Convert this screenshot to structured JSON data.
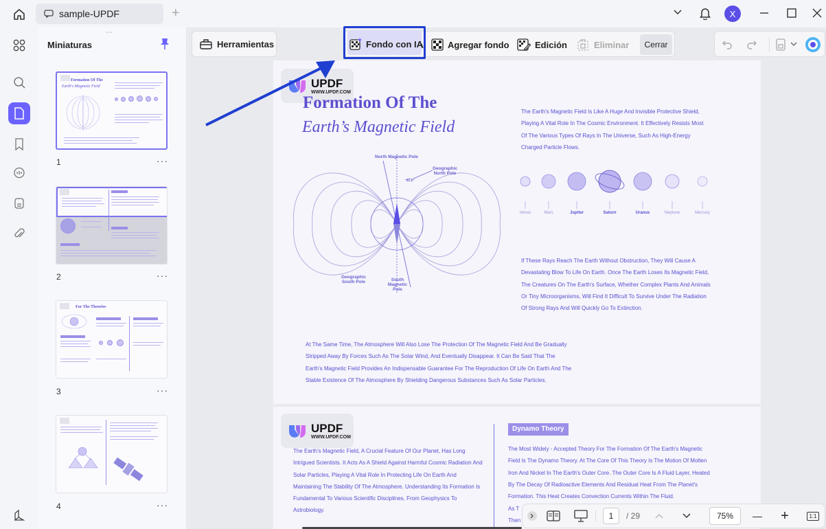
{
  "window": {
    "tab_title": "sample-UPDF",
    "new_tab": "+",
    "avatar_letter": "X",
    "accent": "#6c63ff"
  },
  "rail": {
    "items": [
      "apps-icon",
      "search-icon",
      "pages-icon",
      "bookmark-icon",
      "comment-icon",
      "stamp-icon",
      "attachment-icon",
      "layers-icon"
    ]
  },
  "thumbnails": {
    "title": "Miniaturas",
    "more": "···",
    "drag_handle": "⋯",
    "pages": [
      {
        "number": "1",
        "heading": "Formation Of The",
        "subheading": "Earth's Magnetic Field"
      },
      {
        "number": "2"
      },
      {
        "number": "3",
        "heading": "For The Theories"
      },
      {
        "number": "4"
      }
    ]
  },
  "toolbar": {
    "tools_label": "Herramientas",
    "ai_background_label": "Fondo con IA",
    "add_background_label": "Agregar fondo",
    "edit_label": "Edición",
    "delete_label": "Eliminar",
    "close_label": "Cerrar"
  },
  "page1": {
    "logo_text": "UPDF",
    "logo_url": "WWW.UPDF.COM",
    "title_line1": "Formation Of The",
    "title_line2": "Earth’s Magnetic Field",
    "intro": "The Earth's Magnetic Field Is Like A Huge And Invisible Protective Shield, Playing A Vital Role In The Cosmic Environment. It Effectively Resists Most Of The Various Types Of Rays In The Universe, Such As High-Energy Charged Particle Flows.",
    "rays": "If These Rays Reach The Earth Without Obstruction, They Will Cause A Devastating Blow To Life On Earth. Once The Earth Loses Its Magnetic Field, The Creatures On The Earth's Surface, Whether Complex Plants And Animals Or Tiny Microorganisms, Will Find It Difficult To Survive Under The Radiation Of Strong Rays And Will Quickly Go To Extinction.",
    "atmosphere": "At The Same Time, The Atmosphere Will Also Lose The Protection Of The Magnetic Field And Be Gradually Stripped Away By Forces Such As The Solar Wind, And Eventually Disappear. It Can Be Said That The Earth's Magnetic Field Provides An Indispensable Guarantee For The Reproduction Of Life On Earth And The Stable Existence Of The Atmosphere By Shielding Dangerous Substances Such As Solar Particles.",
    "diagram": {
      "north_magnetic_pole": "North Magnetic Pole",
      "geographic_north_pole": "Geographic North Pole",
      "geographic_south_pole": "Geographic South Pole",
      "south_magnetic_pole": "South Magnetic Pole",
      "angle": "11.5°"
    },
    "planets": [
      "Venus",
      "Mars",
      "Jupiter",
      "Saturn",
      "Uranus",
      "Neptune",
      "Mercury"
    ],
    "planets_bold": [
      false,
      false,
      true,
      true,
      true,
      false,
      false
    ]
  },
  "page2": {
    "logo_text": "UPDF",
    "logo_url": "WWW.UPDF.COM",
    "left_text": "The Earth's Magnetic Field, A Crucial Feature Of Our Planet, Has Long Intrigued Scientists. It Acts As A Shield Against Harmful Cosmic Radiation And Solar Particles, Playing A Vital Role In Protecting Life On Earth And Maintaining The Stability Of The Atmosphere. Understanding Its Formation Is Fundamental To Various Scientific Disciplines, From Geophysics To Astrobiology.",
    "dynamo_title": "Dynamo Theory",
    "dynamo_text": "The Most Widely - Accepted Theory For The Formation Of The Earth's Magnetic Field Is The Dynamo Theory. At The Core Of This Theory Is The Motion Of Molten Iron And Nickel In The Earth's Outer Core. The Outer Core Is A Fluid Layer, Heated By The Decay Of Radioactive Elements And Residual Heat From The Planet's Formation. This Heat Creates Convection Currents Within The Fluid.",
    "cut_line1": "As T",
    "cut_line2": "Then"
  },
  "bottom": {
    "current_page": "1",
    "total_pages": "/ 29",
    "zoom": "75%",
    "minus": "—",
    "plus": "+",
    "fit": "1:1"
  }
}
